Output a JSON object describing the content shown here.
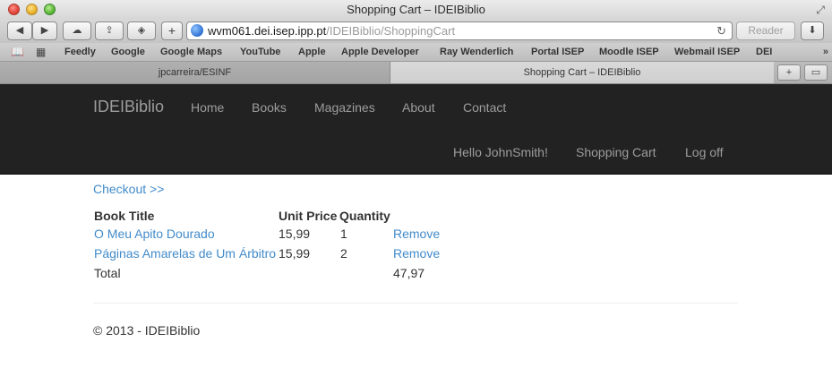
{
  "window": {
    "title": "Shopping Cart – IDEIBiblio"
  },
  "toolbar": {
    "back_icon": "back-arrow-icon",
    "forward_icon": "forward-arrow-icon",
    "icloud_icon": "cloud-icon",
    "share_icon": "share-icon",
    "tabs_icon": "layers-icon",
    "add_label": "+",
    "url_host": "wvm061.dei.isep.ipp.pt",
    "url_path": "/IDEIBiblio/ShoppingCart",
    "reader_label": "Reader",
    "download_icon": "download-icon"
  },
  "bookmarks": {
    "items": [
      "Feedly",
      "Google",
      "Google Maps",
      "YouTube",
      "Apple",
      "Apple Developer",
      "Ray Wenderlich",
      "Portal ISEP",
      "Moodle ISEP",
      "Webmail ISEP",
      "DEI"
    ],
    "more": "»"
  },
  "tabs": {
    "items": [
      {
        "label": "jpcarreira/ESINF"
      },
      {
        "label": "Shopping Cart – IDEIBiblio"
      }
    ]
  },
  "navbar": {
    "brand": "IDEIBiblio",
    "links": [
      "Home",
      "Books",
      "Magazines",
      "About",
      "Contact"
    ],
    "user_links": [
      "Hello JohnSmith!",
      "Shopping Cart",
      "Log off"
    ],
    "background": "#222222"
  },
  "cart": {
    "checkout_label": "Checkout >>",
    "columns": [
      "Book Title",
      "Unit Price",
      "Quantity"
    ],
    "rows": [
      {
        "title": "O Meu Apito Dourado",
        "price": "15,99",
        "quantity": "1",
        "action": "Remove"
      },
      {
        "title": "Páginas Amarelas de Um Árbitro",
        "price": "15,99",
        "quantity": "2",
        "action": "Remove"
      }
    ],
    "total_label": "Total",
    "total_value": "47,97",
    "link_color": "#428bca"
  },
  "footer": {
    "text": "© 2013 - IDEIBiblio"
  }
}
